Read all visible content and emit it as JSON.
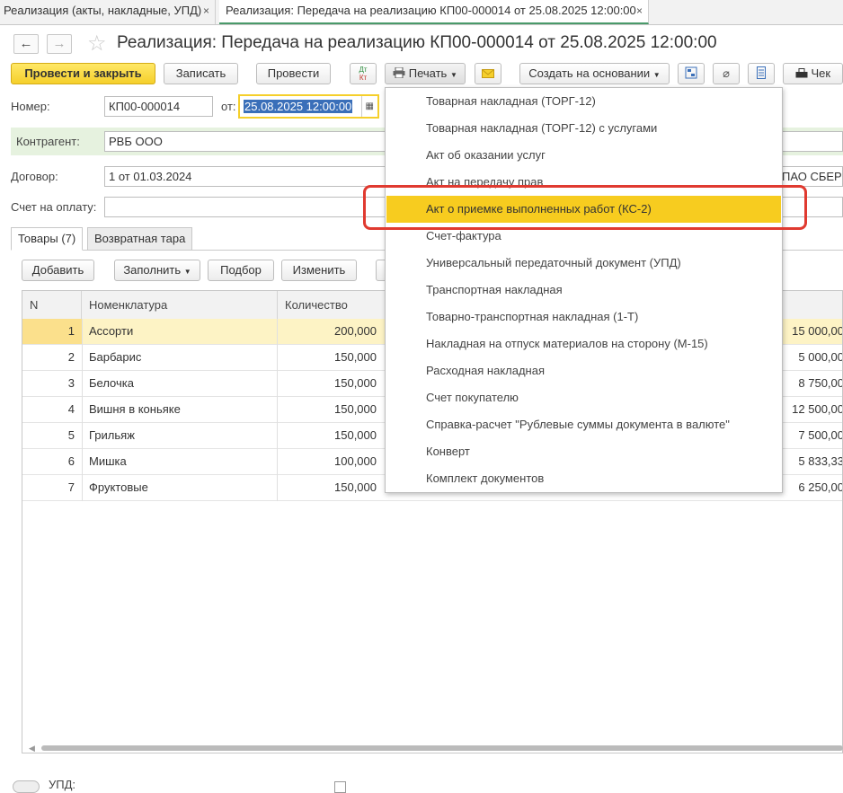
{
  "tabs": [
    {
      "label": "Реализация (акты, накладные, УПД)",
      "close": "×"
    },
    {
      "label": "Реализация: Передача на реализацию КП00-000014 от 25.08.2025 12:00:00",
      "close": "×"
    }
  ],
  "nav": {
    "back": "←",
    "forward": "→"
  },
  "title": "Реализация: Передача на реализацию КП00-000014 от 25.08.2025 12:00:00",
  "toolbar": {
    "post_close": "Провести и закрыть",
    "save": "Записать",
    "post": "Провести",
    "dtkt_top": "Дт",
    "dtkt_bottom": "Кт",
    "print": "Печать",
    "create_based": "Создать на основании",
    "receipt": "Чек"
  },
  "form": {
    "number_label": "Номер:",
    "number_value": "КП00-000014",
    "date_label": "от:",
    "date_value": "25.08.2025 12:00:00",
    "counterparty_label": "Контрагент:",
    "counterparty_value": "РВБ ООО",
    "contract_label": "Договор:",
    "contract_value": "1 от 01.03.2024",
    "bank_partial": "ПАО СБЕР",
    "invoice_label": "Счет на оплату:"
  },
  "subtabs": [
    "Товары (7)",
    "Возвратная тара"
  ],
  "table_toolbar": {
    "add": "Добавить",
    "fill": "Заполнить",
    "pick": "Подбор",
    "change": "Изменить"
  },
  "table": {
    "headers": [
      "N",
      "Номенклатура",
      "Количество"
    ],
    "rows": [
      {
        "n": "1",
        "name": "Ассорти",
        "qty": "200,000",
        "sum": "15 000,00"
      },
      {
        "n": "2",
        "name": "Барбарис",
        "qty": "150,000",
        "sum": "5 000,00"
      },
      {
        "n": "3",
        "name": "Белочка",
        "qty": "150,000",
        "sum": "8 750,00"
      },
      {
        "n": "4",
        "name": "Вишня в коньяке",
        "qty": "150,000",
        "sum": "12 500,00"
      },
      {
        "n": "5",
        "name": "Грильяж",
        "qty": "150,000",
        "sum": "7 500,00"
      },
      {
        "n": "6",
        "name": "Мишка",
        "qty": "100,000",
        "sum": "5 833,33"
      },
      {
        "n": "7",
        "name": "Фруктовые",
        "qty": "150,000",
        "sum": "6 250,00"
      }
    ]
  },
  "print_menu": {
    "items": [
      "Товарная накладная (ТОРГ-12)",
      "Товарная накладная (ТОРГ-12) с услугами",
      "Акт об оказании услуг",
      "Акт на передачу прав",
      "Акт о приемке выполненных работ (КС-2)",
      "Счет-фактура",
      "Универсальный передаточный документ (УПД)",
      "Транспортная накладная",
      "Товарно-транспортная накладная (1-Т)",
      "Накладная на отпуск материалов на сторону (М-15)",
      "Расходная накладная",
      "Счет покупателю",
      "Справка-расчет \"Рублевые суммы документа в валюте\"",
      "Конверт",
      "Комплект документов"
    ],
    "highlighted_index": 4
  },
  "bottom": {
    "upd_label": "УПД:"
  },
  "colors": {
    "primary": "#f5cf2b",
    "highlight": "#f7cc1f",
    "annotation": "#e03a30",
    "selected_row": "#fdf3c5"
  }
}
